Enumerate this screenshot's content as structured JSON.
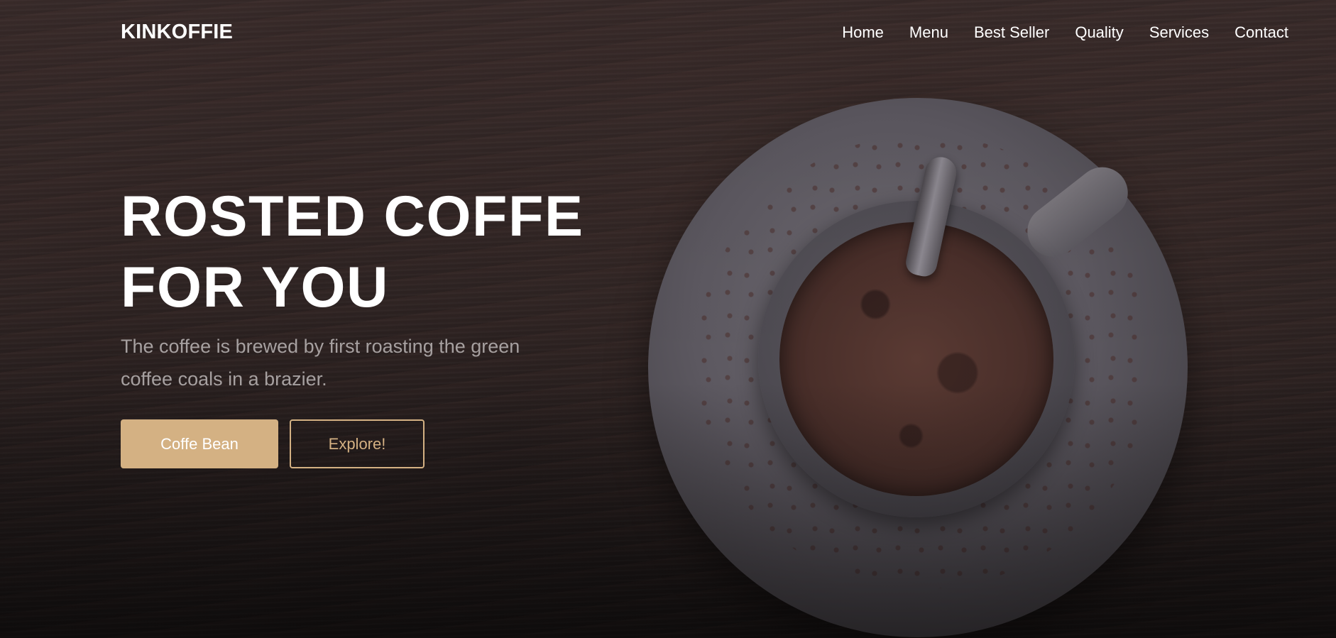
{
  "brand": {
    "logo": "KINKOFFIE"
  },
  "nav": {
    "items": [
      {
        "label": "Home"
      },
      {
        "label": "Menu"
      },
      {
        "label": "Best Seller"
      },
      {
        "label": "Quality"
      },
      {
        "label": "Services"
      },
      {
        "label": "Contact"
      }
    ]
  },
  "hero": {
    "headline_line1": "ROSTED COFFE",
    "headline_line2": "FOR YOU",
    "subtitle": "The coffee is brewed by first roasting the green coffee coals in a brazier.",
    "primary_button": "Coffe Bean",
    "secondary_button": "Explore!"
  },
  "colors": {
    "accent": "#d4b183",
    "text": "#ffffff",
    "subtitle": "#a6a0a0",
    "background": "#2f2423"
  },
  "icons": {
    "hero_image": "coffee-cup-on-saucer"
  }
}
